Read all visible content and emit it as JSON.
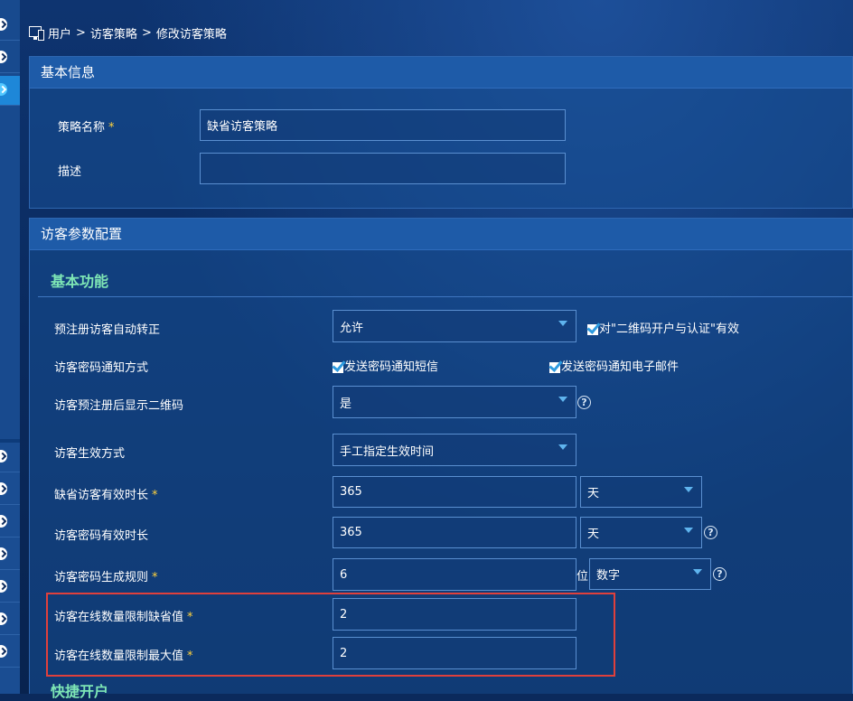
{
  "breadcrumb": {
    "items": [
      "用户",
      "访客策略",
      "修改访客策略"
    ],
    "separator": ">"
  },
  "basic_info": {
    "title": "基本信息",
    "policy_name_label": "策略名称",
    "policy_name_value": "缺省访客策略",
    "description_label": "描述",
    "description_value": ""
  },
  "visitor_config": {
    "title": "访客参数配置",
    "section_basic": "基本功能",
    "section_quick": "快捷开户",
    "auto_convert_label": "预注册访客自动转正",
    "auto_convert_value": "允许",
    "qr_open_label": "对\"二维码开户与认证\"有效",
    "notify_method_label": "访客密码通知方式",
    "notify_sms_label": "发送密码通知短信",
    "notify_email_label": "发送密码通知电子邮件",
    "show_qr_label": "访客预注册后显示二维码",
    "show_qr_value": "是",
    "effect_mode_label": "访客生效方式",
    "effect_mode_value": "手工指定生效时间",
    "default_duration_label": "缺省访客有效时长",
    "default_duration_value": "365",
    "default_duration_unit": "天",
    "pwd_duration_label": "访客密码有效时长",
    "pwd_duration_value": "365",
    "pwd_duration_unit": "天",
    "pwd_rule_label": "访客密码生成规则",
    "pwd_rule_value": "6",
    "pwd_rule_suffix": "位",
    "pwd_rule_type": "数字",
    "online_default_label": "访客在线数量限制缺省值",
    "online_default_value": "2",
    "online_max_label": "访客在线数量限制最大值",
    "online_max_value": "2"
  },
  "required_mark": "*",
  "help_icon_text": "?",
  "colors": {
    "section_title": "#7ee6b5",
    "required": "#ffd23c",
    "highlight_border": "#e0403c",
    "panel_header": "#1e5ba8"
  }
}
